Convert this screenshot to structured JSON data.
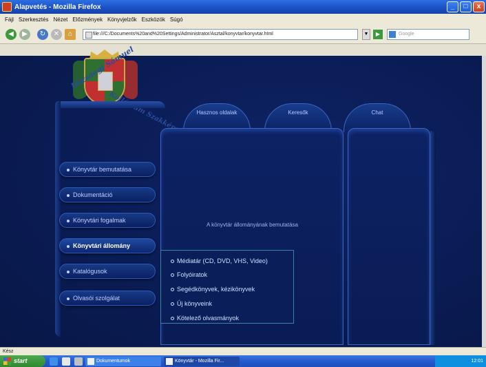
{
  "window": {
    "title": "Alapvetés - Mozilla Firefox",
    "min_glyph": "_",
    "max_glyph": "□",
    "close_glyph": "x"
  },
  "menubar": [
    "Fájl",
    "Szerkesztés",
    "Nézet",
    "Előzmények",
    "Könyvjelzők",
    "Eszközök",
    "Súgó"
  ],
  "toolbar": {
    "back_glyph": "◀",
    "forward_glyph": "▶",
    "reload_glyph": "↻",
    "stop_glyph": "✕",
    "home_glyph": "⌂",
    "url": "file:///C:/Documents%20and%20Settings/Administrator/Asztal/konyvtar/konyvtar.html",
    "dropdown_glyph": "▼",
    "go_glyph": "▶",
    "search_placeholder": "Google"
  },
  "site": {
    "crest_text_top": "Dózsaegi Sámuel",
    "crest_text_bottom": "Kollégium Szakképző Iskola",
    "nav": [
      {
        "label": "Könyvtár bemutatása",
        "active": false
      },
      {
        "label": "Dokumentáció",
        "active": false
      },
      {
        "label": "Könyvtári fogalmak",
        "active": false
      },
      {
        "label": "Könyvtári állomány",
        "active": true
      },
      {
        "label": "Katalógusok",
        "active": false
      },
      {
        "label": "Olvasói szolgálat",
        "active": false
      }
    ],
    "tabs": [
      {
        "label": "Hasznos oldalak"
      },
      {
        "label": "Keresők"
      },
      {
        "label": "Chat"
      }
    ],
    "main_caption": "A könyvtár állományának bemutatása",
    "submenu": [
      "Médiatár (CD, DVD, VHS, Video)",
      "Folyóiratok",
      "Segédkönyvek, kézikönyvek",
      "Új könyveink",
      "Kötelező olvasmányok"
    ]
  },
  "statusbar": {
    "text": "Kész"
  },
  "taskbar": {
    "start_label": "start",
    "items": [
      {
        "label": "Dokumentumok"
      },
      {
        "label": "Könyvtár - Mozilla Fir..."
      }
    ],
    "clock": "12:01"
  }
}
